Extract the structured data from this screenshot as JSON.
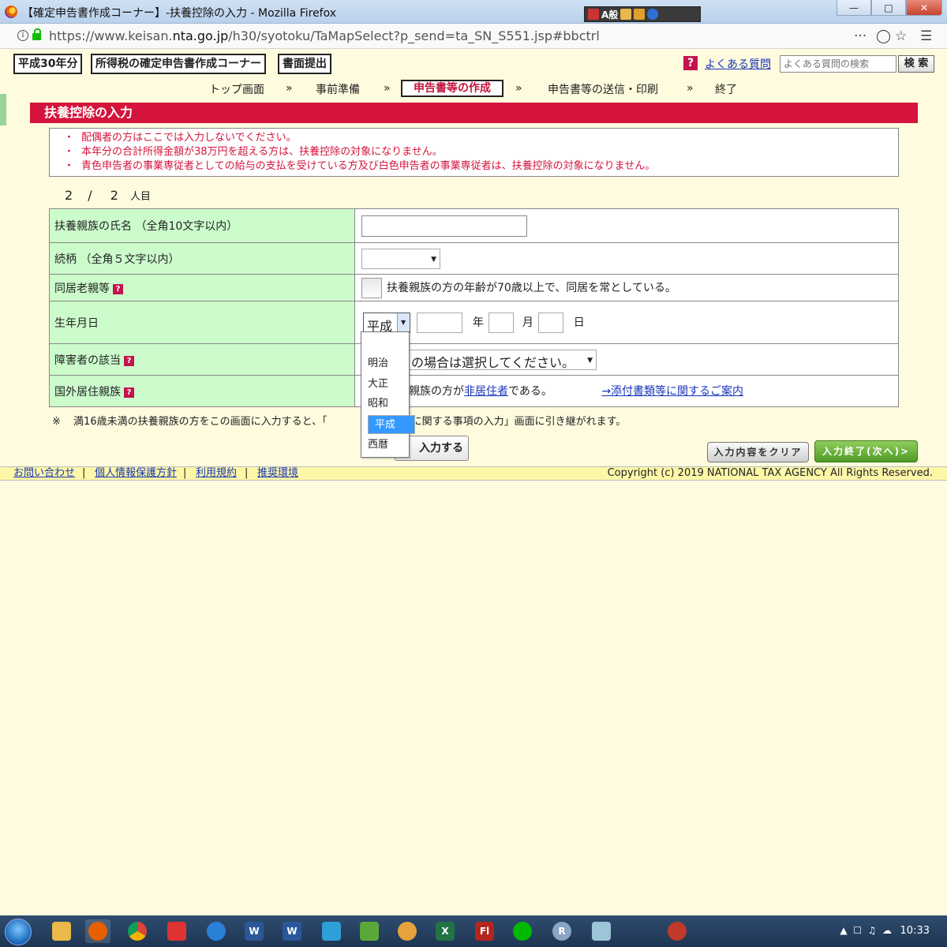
{
  "browser": {
    "window_title": "【確定申告書作成コーナー】-扶養控除の入力 - Mozilla Firefox",
    "url_prefix": "https://www.keisan.",
    "url_domain": "nta.go.jp",
    "url_path": "/h30/syotoku/TaMapSelect?p_send=ta_SN_S551.jsp#bbctrl",
    "ime_text": "A般"
  },
  "header": {
    "tag_year": "平成30年分",
    "tag_corner": "所得税の確定申告書作成コーナー",
    "tag_submit": "書面提出",
    "help_badge": "?",
    "faq_link": "よくある質問",
    "faq_search_placeholder": "よくある質問の検索",
    "faq_search_button": "検 索"
  },
  "steps": {
    "items": [
      "トップ画面",
      "事前準備",
      "申告書等の作成",
      "申告書等の送信・印刷",
      "終了"
    ],
    "arrow": "»"
  },
  "section_title": "扶養控除の入力",
  "notes": [
    "配偶者の方はここでは入力しないでください。",
    "本年分の合計所得金額が38万円を超える方は、扶養控除の対象になりません。",
    "青色申告者の事業専従者としての給与の支払を受けている方及び白色申告者の事業専従者は、扶養控除の対象になりません。"
  ],
  "note_bullet": "・",
  "count": {
    "current": "2",
    "slash": "/",
    "total": "2",
    "unit": "人目"
  },
  "form": {
    "name_label": "扶養親族の氏名 （全角10文字以内）",
    "relation_label": "続柄 （全角５文字以内）",
    "cohabit_label": "同居老親等",
    "cohabit_text": "扶養親族の方の年齢が70歳以上で、同居を常としている。",
    "birth_label": "生年月日",
    "era_value": "平成",
    "year_unit": "年",
    "month_unit": "月",
    "day_unit": "日",
    "disability_label": "障害者の該当",
    "disability_value": "の場合は選択してください。",
    "overseas_label": "国外居住親族",
    "overseas_text_pre": "親族の方が",
    "overseas_link": "非居住者",
    "overseas_text_post": "である。",
    "attachment_link": "→添付書類等に関するご案内",
    "help_badge": "?"
  },
  "footnote": {
    "mark": "※",
    "text_a": "満16歳未満の扶養親族の方をこの画面に入力すると、「",
    "text_b": "事業税に関する事項の入力」画面に引き継がれます。"
  },
  "buttons": {
    "add": "入力する",
    "clear": "入力内容をクリア",
    "next": "入力終了(次へ)>"
  },
  "era_dropdown": {
    "options": [
      "明治",
      "大正",
      "昭和",
      "平成",
      "西暦"
    ],
    "selected": "平成"
  },
  "footer": {
    "links": [
      "お問い合わせ",
      "個人情報保護方針",
      "利用規約",
      "推奨環境"
    ],
    "separator": "|",
    "copyright": "Copyright (c) 2019 NATIONAL TAX AGENCY All Rights Reserved."
  },
  "taskbar": {
    "clock": "10:33",
    "apps": [
      "explorer",
      "firefox",
      "chrome",
      "camera",
      "ie",
      "word-doc",
      "word",
      "maps",
      "evernote",
      "preview",
      "excel",
      "flash",
      "line",
      "r",
      "notes",
      "app"
    ]
  },
  "colors": {
    "brand_red": "#d4143c",
    "form_label_bg": "#ccfccc",
    "page_bg": "#fefbdf",
    "link_blue": "#1a35b8",
    "selected_blue": "#3399ff"
  }
}
